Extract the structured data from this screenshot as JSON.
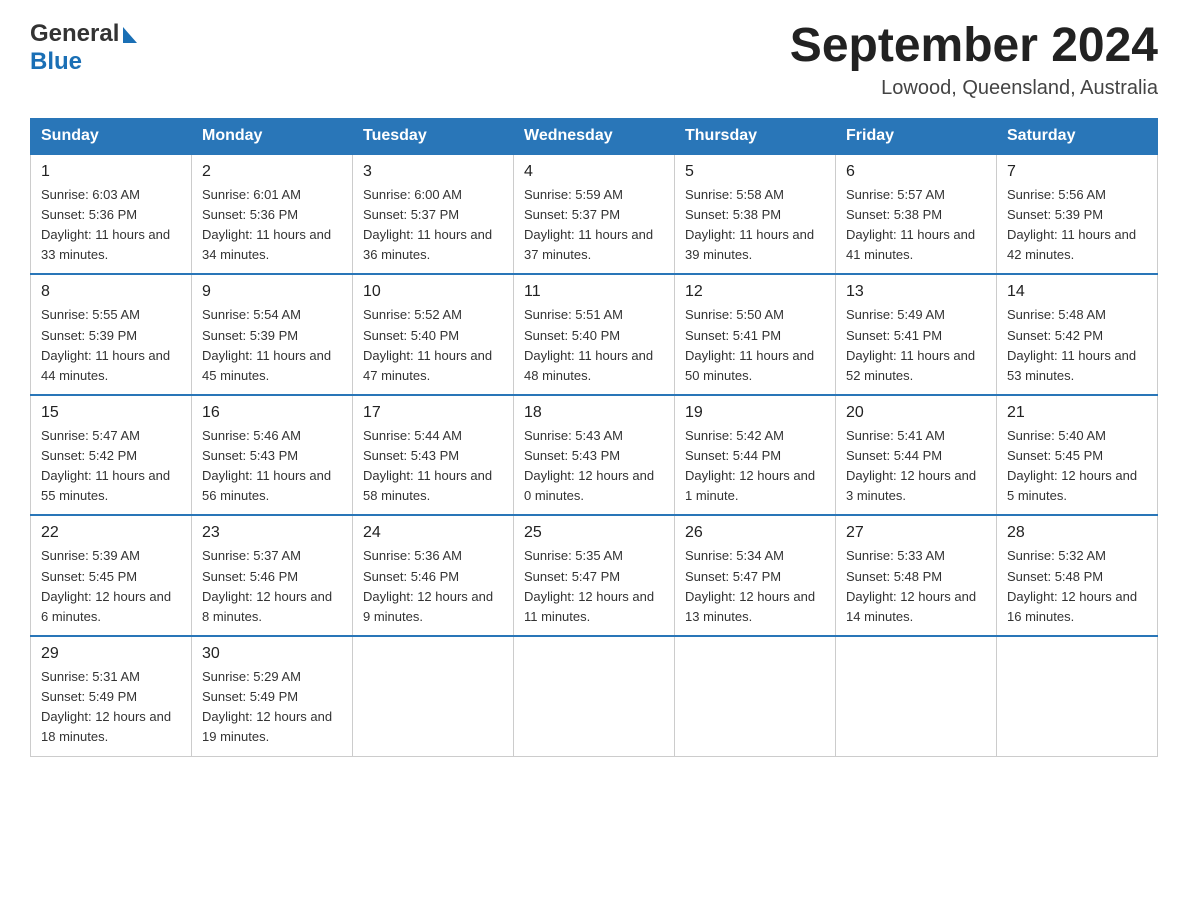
{
  "header": {
    "logo_general": "General",
    "logo_blue": "Blue",
    "title": "September 2024",
    "subtitle": "Lowood, Queensland, Australia"
  },
  "days_of_week": [
    "Sunday",
    "Monday",
    "Tuesday",
    "Wednesday",
    "Thursday",
    "Friday",
    "Saturday"
  ],
  "weeks": [
    [
      {
        "day": "1",
        "sunrise": "6:03 AM",
        "sunset": "5:36 PM",
        "daylight": "11 hours and 33 minutes."
      },
      {
        "day": "2",
        "sunrise": "6:01 AM",
        "sunset": "5:36 PM",
        "daylight": "11 hours and 34 minutes."
      },
      {
        "day": "3",
        "sunrise": "6:00 AM",
        "sunset": "5:37 PM",
        "daylight": "11 hours and 36 minutes."
      },
      {
        "day": "4",
        "sunrise": "5:59 AM",
        "sunset": "5:37 PM",
        "daylight": "11 hours and 37 minutes."
      },
      {
        "day": "5",
        "sunrise": "5:58 AM",
        "sunset": "5:38 PM",
        "daylight": "11 hours and 39 minutes."
      },
      {
        "day": "6",
        "sunrise": "5:57 AM",
        "sunset": "5:38 PM",
        "daylight": "11 hours and 41 minutes."
      },
      {
        "day": "7",
        "sunrise": "5:56 AM",
        "sunset": "5:39 PM",
        "daylight": "11 hours and 42 minutes."
      }
    ],
    [
      {
        "day": "8",
        "sunrise": "5:55 AM",
        "sunset": "5:39 PM",
        "daylight": "11 hours and 44 minutes."
      },
      {
        "day": "9",
        "sunrise": "5:54 AM",
        "sunset": "5:39 PM",
        "daylight": "11 hours and 45 minutes."
      },
      {
        "day": "10",
        "sunrise": "5:52 AM",
        "sunset": "5:40 PM",
        "daylight": "11 hours and 47 minutes."
      },
      {
        "day": "11",
        "sunrise": "5:51 AM",
        "sunset": "5:40 PM",
        "daylight": "11 hours and 48 minutes."
      },
      {
        "day": "12",
        "sunrise": "5:50 AM",
        "sunset": "5:41 PM",
        "daylight": "11 hours and 50 minutes."
      },
      {
        "day": "13",
        "sunrise": "5:49 AM",
        "sunset": "5:41 PM",
        "daylight": "11 hours and 52 minutes."
      },
      {
        "day": "14",
        "sunrise": "5:48 AM",
        "sunset": "5:42 PM",
        "daylight": "11 hours and 53 minutes."
      }
    ],
    [
      {
        "day": "15",
        "sunrise": "5:47 AM",
        "sunset": "5:42 PM",
        "daylight": "11 hours and 55 minutes."
      },
      {
        "day": "16",
        "sunrise": "5:46 AM",
        "sunset": "5:43 PM",
        "daylight": "11 hours and 56 minutes."
      },
      {
        "day": "17",
        "sunrise": "5:44 AM",
        "sunset": "5:43 PM",
        "daylight": "11 hours and 58 minutes."
      },
      {
        "day": "18",
        "sunrise": "5:43 AM",
        "sunset": "5:43 PM",
        "daylight": "12 hours and 0 minutes."
      },
      {
        "day": "19",
        "sunrise": "5:42 AM",
        "sunset": "5:44 PM",
        "daylight": "12 hours and 1 minute."
      },
      {
        "day": "20",
        "sunrise": "5:41 AM",
        "sunset": "5:44 PM",
        "daylight": "12 hours and 3 minutes."
      },
      {
        "day": "21",
        "sunrise": "5:40 AM",
        "sunset": "5:45 PM",
        "daylight": "12 hours and 5 minutes."
      }
    ],
    [
      {
        "day": "22",
        "sunrise": "5:39 AM",
        "sunset": "5:45 PM",
        "daylight": "12 hours and 6 minutes."
      },
      {
        "day": "23",
        "sunrise": "5:37 AM",
        "sunset": "5:46 PM",
        "daylight": "12 hours and 8 minutes."
      },
      {
        "day": "24",
        "sunrise": "5:36 AM",
        "sunset": "5:46 PM",
        "daylight": "12 hours and 9 minutes."
      },
      {
        "day": "25",
        "sunrise": "5:35 AM",
        "sunset": "5:47 PM",
        "daylight": "12 hours and 11 minutes."
      },
      {
        "day": "26",
        "sunrise": "5:34 AM",
        "sunset": "5:47 PM",
        "daylight": "12 hours and 13 minutes."
      },
      {
        "day": "27",
        "sunrise": "5:33 AM",
        "sunset": "5:48 PM",
        "daylight": "12 hours and 14 minutes."
      },
      {
        "day": "28",
        "sunrise": "5:32 AM",
        "sunset": "5:48 PM",
        "daylight": "12 hours and 16 minutes."
      }
    ],
    [
      {
        "day": "29",
        "sunrise": "5:31 AM",
        "sunset": "5:49 PM",
        "daylight": "12 hours and 18 minutes."
      },
      {
        "day": "30",
        "sunrise": "5:29 AM",
        "sunset": "5:49 PM",
        "daylight": "12 hours and 19 minutes."
      },
      null,
      null,
      null,
      null,
      null
    ]
  ],
  "labels": {
    "sunrise": "Sunrise:",
    "sunset": "Sunset:",
    "daylight": "Daylight:"
  }
}
